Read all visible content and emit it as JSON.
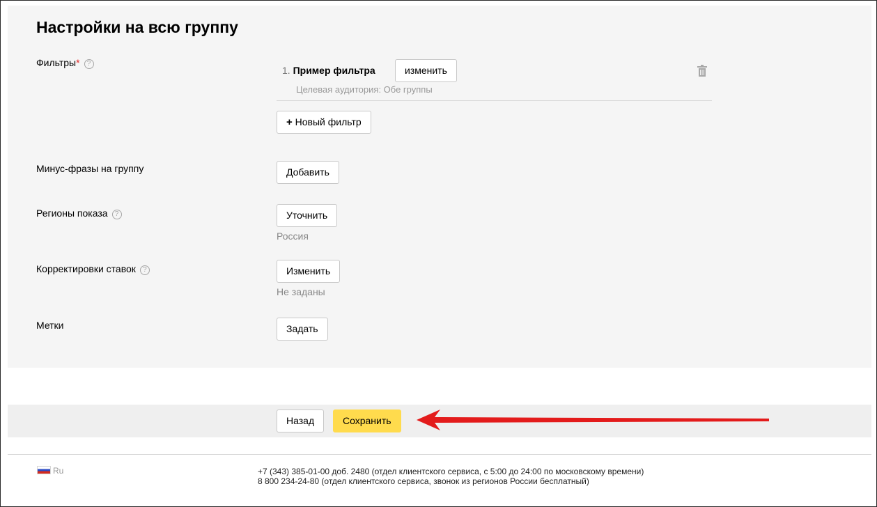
{
  "page_title": "Настройки на всю группу",
  "help_glyph": "?",
  "filters": {
    "label": "Фильтры",
    "required_mark": "*",
    "items": [
      {
        "number": "1.",
        "name": "Пример фильтра",
        "edit_label": "изменить",
        "audience": "Целевая аудитория: Обе группы"
      }
    ],
    "new_filter_plus": "+",
    "new_filter_label": "Новый фильтр"
  },
  "negative_phrases": {
    "label": "Минус-фразы на группу",
    "button": "Добавить"
  },
  "regions": {
    "label": "Регионы показа",
    "button": "Уточнить",
    "value": "Россия"
  },
  "bid_adjustments": {
    "label": "Корректировки ставок",
    "button": "Изменить",
    "value": "Не заданы"
  },
  "tags": {
    "label": "Метки",
    "button": "Задать"
  },
  "actions": {
    "back": "Назад",
    "save": "Сохранить"
  },
  "footer": {
    "language": "Ru",
    "phone_1": "+7 (343) 385-01-00 доб. 2480 (отдел клиентского сервиса, с 5:00 до 24:00 по московскому времени)",
    "phone_2": "8 800 234-24-80 (отдел клиентского сервиса, звонок из регионов России бесплатный)"
  },
  "colors": {
    "panel_bg": "#f5f5f5",
    "save_button": "#ffdb4d",
    "arrow": "#e31b1b",
    "required": "#e02020"
  },
  "icons": [
    "help-icon",
    "trash-icon",
    "russia-flag-icon",
    "annotation-arrow"
  ]
}
